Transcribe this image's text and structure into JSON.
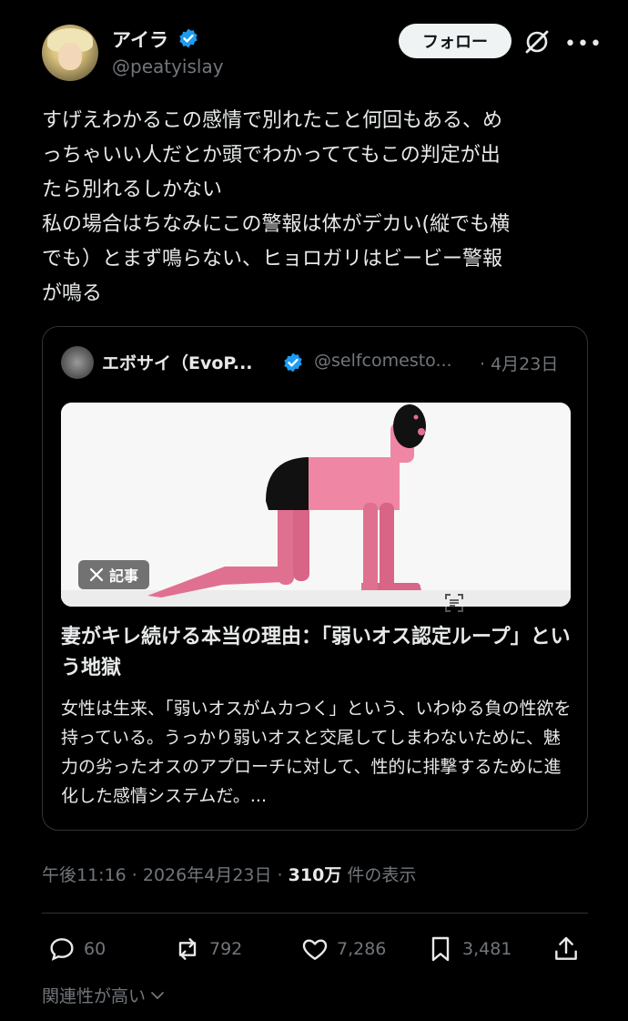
{
  "author": {
    "name": "アイラ",
    "handle": "@peatyislay",
    "follow_label": "フォロー"
  },
  "tweet": {
    "text": "すげえわかるこの感情で別れたこと何回もある、め\nっちゃいい人だとか頭でわかっててもこの判定が出\nたら別れるしかない\n私の場合はちなみにこの警報は体がデカい(縦でも横\nでも）とまず鳴らない、ヒョロガリはビービー警報\nが鳴る"
  },
  "quote": {
    "name": "エボサイ（EvoP...",
    "handle": "@selfcomesto...",
    "date": "· 4月23日",
    "badge_label": "記事",
    "article_title": "妻がキレ続ける本当の理由：「弱いオス認定ループ」という地獄",
    "article_body": "女性は生来、「弱いオスがムカつく」という、いわゆる負の性欲を持っている。うっかり弱いオスと交尾してしまわないために、魅力の劣ったオスのアプローチに対して、性的に排撃するために進化した感情システムだ。..."
  },
  "meta": {
    "time": "午後11:16 · 2026年4月23日 · ",
    "views": "310万",
    "views_suffix": " 件の表示"
  },
  "actions": {
    "replies": "60",
    "retweets": "792",
    "likes": "7,286",
    "bookmarks": "3,481"
  },
  "related_label": "関連性が高い",
  "colors": {
    "background": "#000000",
    "text": "#e7e9ea",
    "muted": "#71767b",
    "verified": "#1d9bf0",
    "border": "#2f3336"
  }
}
